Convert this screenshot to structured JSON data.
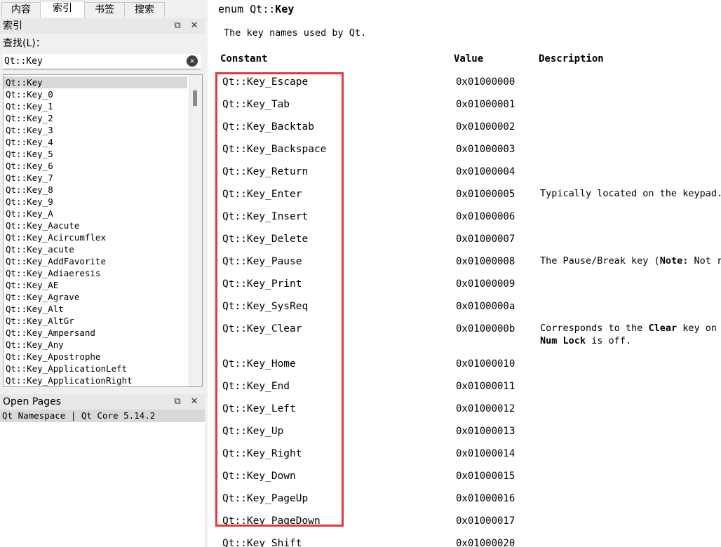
{
  "left_panel": {
    "tabs": [
      {
        "label": "内容",
        "active": false
      },
      {
        "label": "索引",
        "active": true
      },
      {
        "label": "书签",
        "active": false
      },
      {
        "label": "搜索",
        "active": false
      }
    ],
    "index_dock_title": "索引",
    "find_label": "查找(L)：",
    "search_value": "Qt::Key",
    "index_items": [
      "Qt::Key",
      "Qt::Key_0",
      "Qt::Key_1",
      "Qt::Key_2",
      "Qt::Key_3",
      "Qt::Key_4",
      "Qt::Key_5",
      "Qt::Key_6",
      "Qt::Key_7",
      "Qt::Key_8",
      "Qt::Key_9",
      "Qt::Key_A",
      "Qt::Key_Aacute",
      "Qt::Key_Acircumflex",
      "Qt::Key_acute",
      "Qt::Key_AddFavorite",
      "Qt::Key_Adiaeresis",
      "Qt::Key_AE",
      "Qt::Key_Agrave",
      "Qt::Key_Alt",
      "Qt::Key_AltGr",
      "Qt::Key_Ampersand",
      "Qt::Key_Any",
      "Qt::Key_Apostrophe",
      "Qt::Key_ApplicationLeft",
      "Qt::Key_ApplicationRight"
    ],
    "selected_index": 0,
    "open_pages_title": "Open Pages",
    "open_page": "Qt Namespace | Qt Core 5.14.2",
    "float_glyph": "⧉",
    "close_glyph": "✕"
  },
  "doc": {
    "enum_prefix": "enum Qt::",
    "enum_name": "Key",
    "intro": "The key names used by Qt.",
    "headers": {
      "constant": "Constant",
      "value": "Value",
      "description": "Description"
    },
    "highlight_color": "#e03a3e",
    "rows": [
      {
        "constant": "Qt::Key_Escape",
        "value": "0x01000000",
        "desc": []
      },
      {
        "constant": "Qt::Key_Tab",
        "value": "0x01000001",
        "desc": []
      },
      {
        "constant": "Qt::Key_Backtab",
        "value": "0x01000002",
        "desc": []
      },
      {
        "constant": "Qt::Key_Backspace",
        "value": "0x01000003",
        "desc": []
      },
      {
        "constant": "Qt::Key_Return",
        "value": "0x01000004",
        "desc": []
      },
      {
        "constant": "Qt::Key_Enter",
        "value": "0x01000005",
        "desc": [
          [
            {
              "t": "Typically located on the keypad."
            }
          ]
        ]
      },
      {
        "constant": "Qt::Key_Insert",
        "value": "0x01000006",
        "desc": []
      },
      {
        "constant": "Qt::Key_Delete",
        "value": "0x01000007",
        "desc": []
      },
      {
        "constant": "Qt::Key_Pause",
        "value": "0x01000008",
        "desc": [
          [
            {
              "t": "The Pause/Break key ("
            },
            {
              "t": "Note:",
              "b": true
            },
            {
              "t": " Not r"
            }
          ]
        ]
      },
      {
        "constant": "Qt::Key_Print",
        "value": "0x01000009",
        "desc": []
      },
      {
        "constant": "Qt::Key_SysReq",
        "value": "0x0100000a",
        "desc": []
      },
      {
        "constant": "Qt::Key_Clear",
        "value": "0x0100000b",
        "desc": [
          [
            {
              "t": "Corresponds to the "
            },
            {
              "t": "Clear",
              "b": true
            },
            {
              "t": " key on"
            }
          ],
          [
            {
              "t": "Num Lock",
              "b": true
            },
            {
              "t": " is off."
            }
          ]
        ]
      },
      {
        "constant": "Qt::Key_Home",
        "value": "0x01000010",
        "desc": []
      },
      {
        "constant": "Qt::Key_End",
        "value": "0x01000011",
        "desc": []
      },
      {
        "constant": "Qt::Key_Left",
        "value": "0x01000012",
        "desc": []
      },
      {
        "constant": "Qt::Key_Up",
        "value": "0x01000013",
        "desc": []
      },
      {
        "constant": "Qt::Key_Right",
        "value": "0x01000014",
        "desc": []
      },
      {
        "constant": "Qt::Key_Down",
        "value": "0x01000015",
        "desc": []
      },
      {
        "constant": "Qt::Key_PageUp",
        "value": "0x01000016",
        "desc": []
      },
      {
        "constant": "Qt::Key_PageDown",
        "value": "0x01000017",
        "desc": []
      },
      {
        "constant": "Qt::Key_Shift",
        "value": "0x01000020",
        "desc": []
      }
    ]
  }
}
